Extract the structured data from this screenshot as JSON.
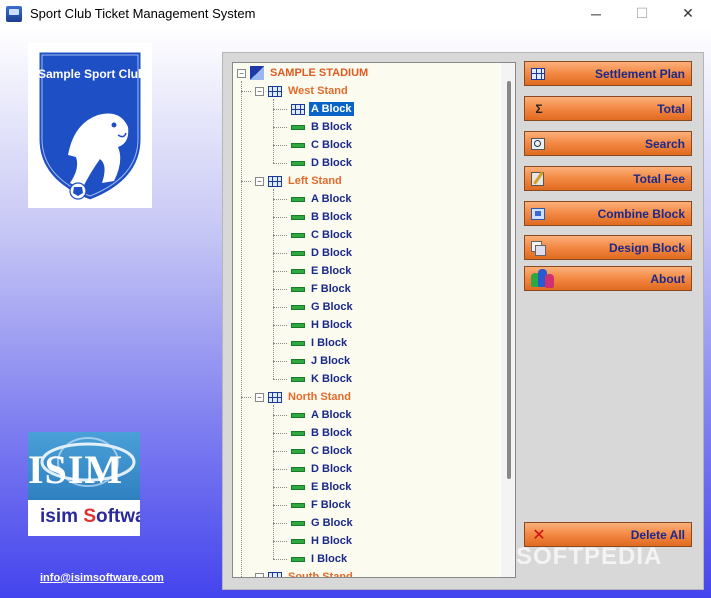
{
  "window": {
    "title": "Sport Club Ticket Management System",
    "minimize_glyph": "─",
    "maximize_glyph": "☐",
    "close_glyph": "✕"
  },
  "logo": {
    "club_name": "Sample Sport Club"
  },
  "isim_logo": {
    "top_text": "ISIM",
    "bottom_prefix": "isim ",
    "bottom_s": "S",
    "bottom_rest": "oftware"
  },
  "email": "info@isimsoftware.com",
  "tree": {
    "root": "SAMPLE STADIUM",
    "stands": [
      {
        "name": "West Stand",
        "blocks": [
          "A Block",
          "B Block",
          "C Block",
          "D Block"
        ],
        "selected": 0
      },
      {
        "name": "Left Stand",
        "blocks": [
          "A Block",
          "B Block",
          "C Block",
          "D Block",
          "E Block",
          "F Block",
          "G Block",
          "H Block",
          "I Block",
          "J Block",
          "K Block"
        ]
      },
      {
        "name": "North Stand",
        "blocks": [
          "A Block",
          "B Block",
          "C Block",
          "D Block",
          "E Block",
          "F Block",
          "G Block",
          "H Block",
          "I Block"
        ]
      },
      {
        "name": "South Stand",
        "blocks": []
      }
    ]
  },
  "buttons": {
    "settlement_plan": "Settlement Plan",
    "total": "Total",
    "total_icon": "Σ",
    "search": "Search",
    "total_fee": "Total Fee",
    "combine_block": "Combine Block",
    "design_block": "Design Block",
    "about": "About",
    "delete_all": "Delete All",
    "delete_icon": "✕"
  },
  "watermark": "SOFTPEDIA",
  "colors": {
    "button_orange": "#f38844",
    "button_text": "#1a2a8a",
    "stand_text": "#e46a2a",
    "selected_bg": "#0a64c8",
    "block_icon": "#2ea840"
  }
}
